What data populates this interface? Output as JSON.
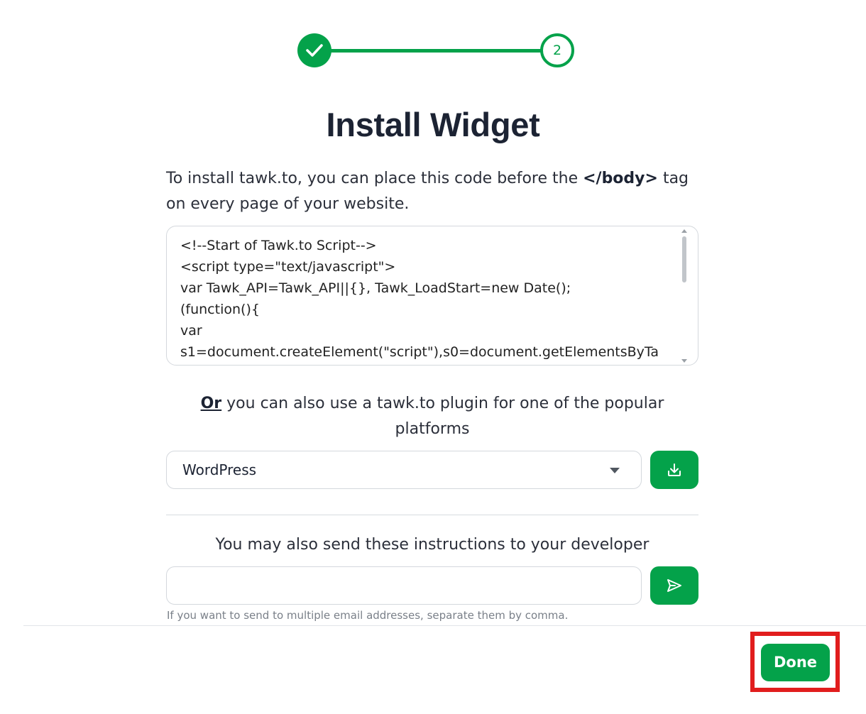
{
  "stepper": {
    "step1_icon": "check-icon",
    "step2_number": "2",
    "accent_color": "#04a24a"
  },
  "title": "Install Widget",
  "intro": {
    "part1": "To install tawk.to, you can place this code before the ",
    "tag": "</body>",
    "part2": " tag on every page of your website."
  },
  "code_lines": [
    "<!--Start of Tawk.to Script-->",
    "<script type=\"text/javascript\">",
    "var Tawk_API=Tawk_API||{}, Tawk_LoadStart=new Date();",
    "(function(){",
    "var",
    "s1=document.createElement(\"script\"),s0=document.getElementsByTa"
  ],
  "plugin": {
    "or_label": "Or",
    "text": " you can also use a tawk.to plugin for one of the popular platforms",
    "selected_platform": "WordPress",
    "download_icon": "download-icon"
  },
  "developer": {
    "text": "You may also send these instructions to your developer",
    "email_placeholder": "",
    "email_value": "",
    "hint": "If you want to send to multiple email addresses, separate them by comma.",
    "send_icon": "send-icon"
  },
  "footer": {
    "done_label": "Done",
    "highlight_color": "#e11d1d"
  }
}
